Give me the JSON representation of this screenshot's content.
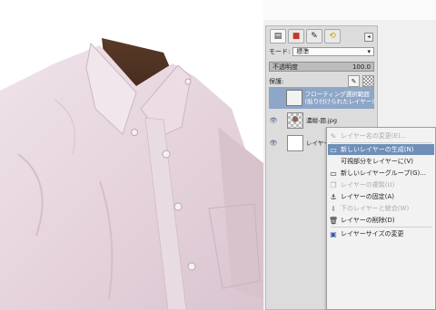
{
  "canvas": {
    "image": "shirt-photo"
  },
  "dock": {
    "tabs": [
      {
        "name": "layers-tab-icon",
        "glyph": "▤"
      },
      {
        "name": "channels-tab-icon",
        "glyph": "■"
      },
      {
        "name": "paths-tab-icon",
        "glyph": "✎"
      },
      {
        "name": "undo-tab-icon",
        "glyph": "⟲"
      }
    ],
    "mode_label": "モード:",
    "mode_value": "標準",
    "opacity_label": "不透明度",
    "opacity_value": "100.0",
    "lock_label": "保護:",
    "layers": [
      {
        "name": "フローティング選択範囲\n(貼り付けられたレイヤー)",
        "thumb": "float",
        "selected": true,
        "visible": false
      },
      {
        "name": "濃紺-囲.jpg",
        "thumb": "photo",
        "selected": false,
        "visible": true
      },
      {
        "name": "レイヤー",
        "thumb": "blank",
        "selected": false,
        "visible": true
      }
    ]
  },
  "context_menu": {
    "items": [
      {
        "label": "レイヤー名の変更(E)...",
        "icon": "✎",
        "state": "disabled"
      },
      {
        "label": "新しいレイヤーの生成(N)",
        "icon": "▭",
        "state": "highlighted"
      },
      {
        "label": "可視部分をレイヤーに(V)",
        "icon": "",
        "state": "normal"
      },
      {
        "label": "新しいレイヤーグループ(G)...",
        "icon": "▭",
        "state": "normal"
      },
      {
        "label": "レイヤーの複製(U)",
        "icon": "❐",
        "state": "disabled"
      },
      {
        "label": "レイヤーの固定(A)",
        "icon": "⚓",
        "state": "normal"
      },
      {
        "label": "下のレイヤーと統合(W)",
        "icon": "⬇",
        "state": "disabled"
      },
      {
        "label": "レイヤーの削除(D)",
        "icon": "🗑",
        "state": "normal"
      },
      {
        "label": "レイヤーサイズの変更",
        "icon": "▣",
        "state": "normal"
      }
    ]
  },
  "colors": {
    "accent": "#6f8fb8",
    "selected_layer": "#8ea6c7",
    "panel": "#dcdcdc"
  }
}
